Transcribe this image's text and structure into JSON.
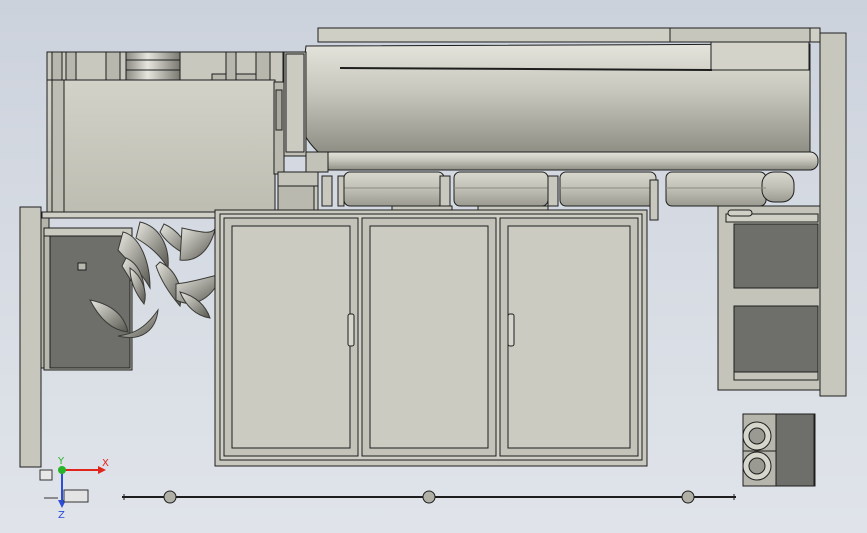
{
  "viewport": {
    "background_top": "#ccd2dc",
    "background_bottom": "#e0e4ea"
  },
  "model": {
    "part_fill": "#c3c3b8",
    "part_fill_light": "#d4d4ca",
    "part_fill_dark": "#a9a99f",
    "edge_color": "#1e1e1e",
    "inner_fill": "#6e6e6a"
  },
  "triad": {
    "x_label": "X",
    "y_label": "Y",
    "z_label": "Z",
    "x_color": "#e0261c",
    "y_color": "#28b428",
    "z_color": "#2a4ed8"
  }
}
